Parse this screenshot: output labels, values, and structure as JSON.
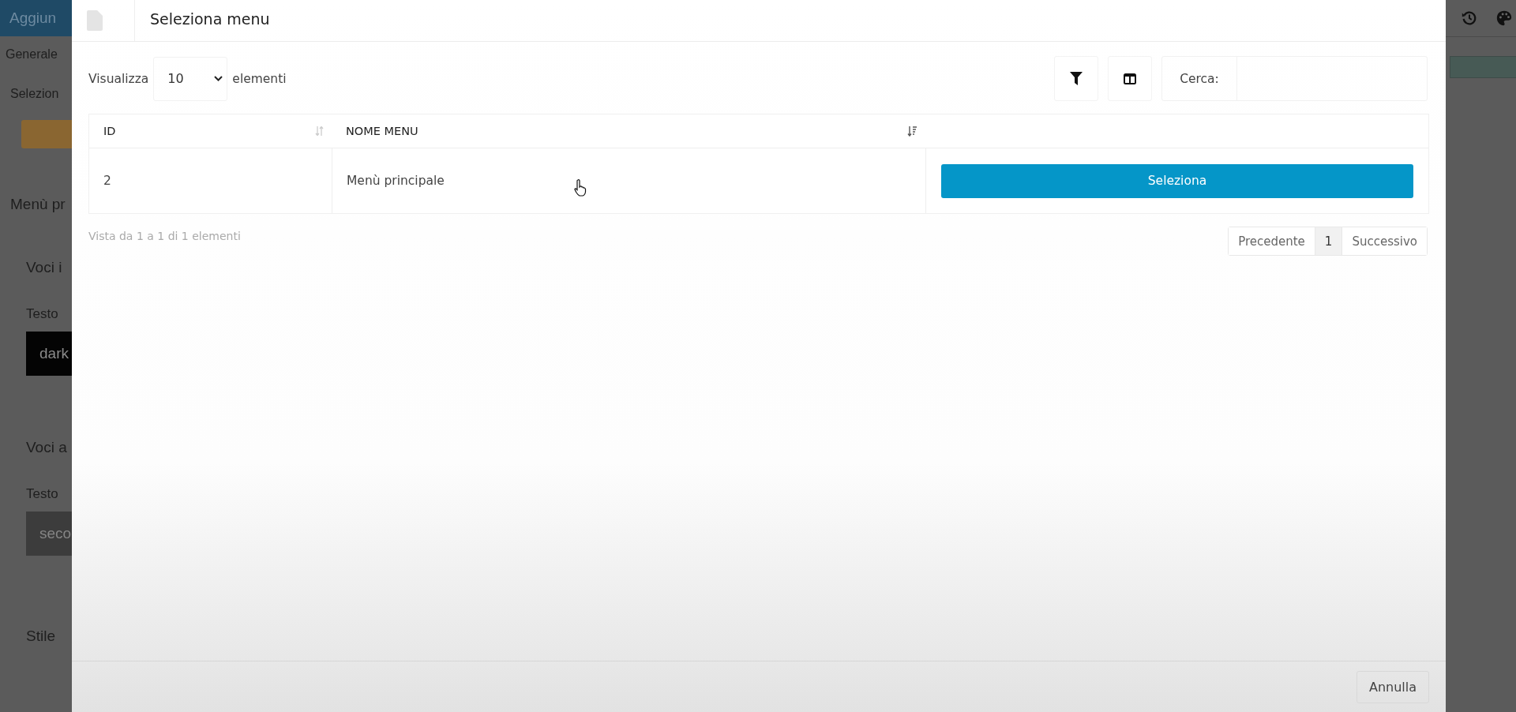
{
  "background_page": {
    "title": "Aggiun",
    "tab": "Generale",
    "field_label": "Selezion",
    "section_title": "Menù pr",
    "groups": [
      {
        "title": "Voci i",
        "label": "Testo",
        "value": "dark",
        "kind": "dark"
      },
      {
        "title": "Voci a",
        "label": "Testo",
        "placeholder": "seco",
        "kind": "secondary"
      }
    ],
    "footer_label": "Stile"
  },
  "modal": {
    "title": "Seleziona menu",
    "length": {
      "label_before": "Visualizza",
      "value": "10",
      "label_after": "elementi"
    },
    "search": {
      "label": "Cerca:"
    },
    "table": {
      "columns": [
        {
          "label": "ID",
          "sorted": false
        },
        {
          "label": "NOME MENU",
          "sorted": true
        }
      ],
      "rows": [
        {
          "id": "2",
          "name": "Menù principale",
          "action": "Seleziona"
        }
      ]
    },
    "info": "Vista da 1 a 1 di 1 elementi",
    "pagination": [
      {
        "label": "Precedente",
        "selected": false
      },
      {
        "label": "1",
        "selected": true
      },
      {
        "label": "Successivo",
        "selected": false
      }
    ],
    "footer_button": "Annulla"
  }
}
